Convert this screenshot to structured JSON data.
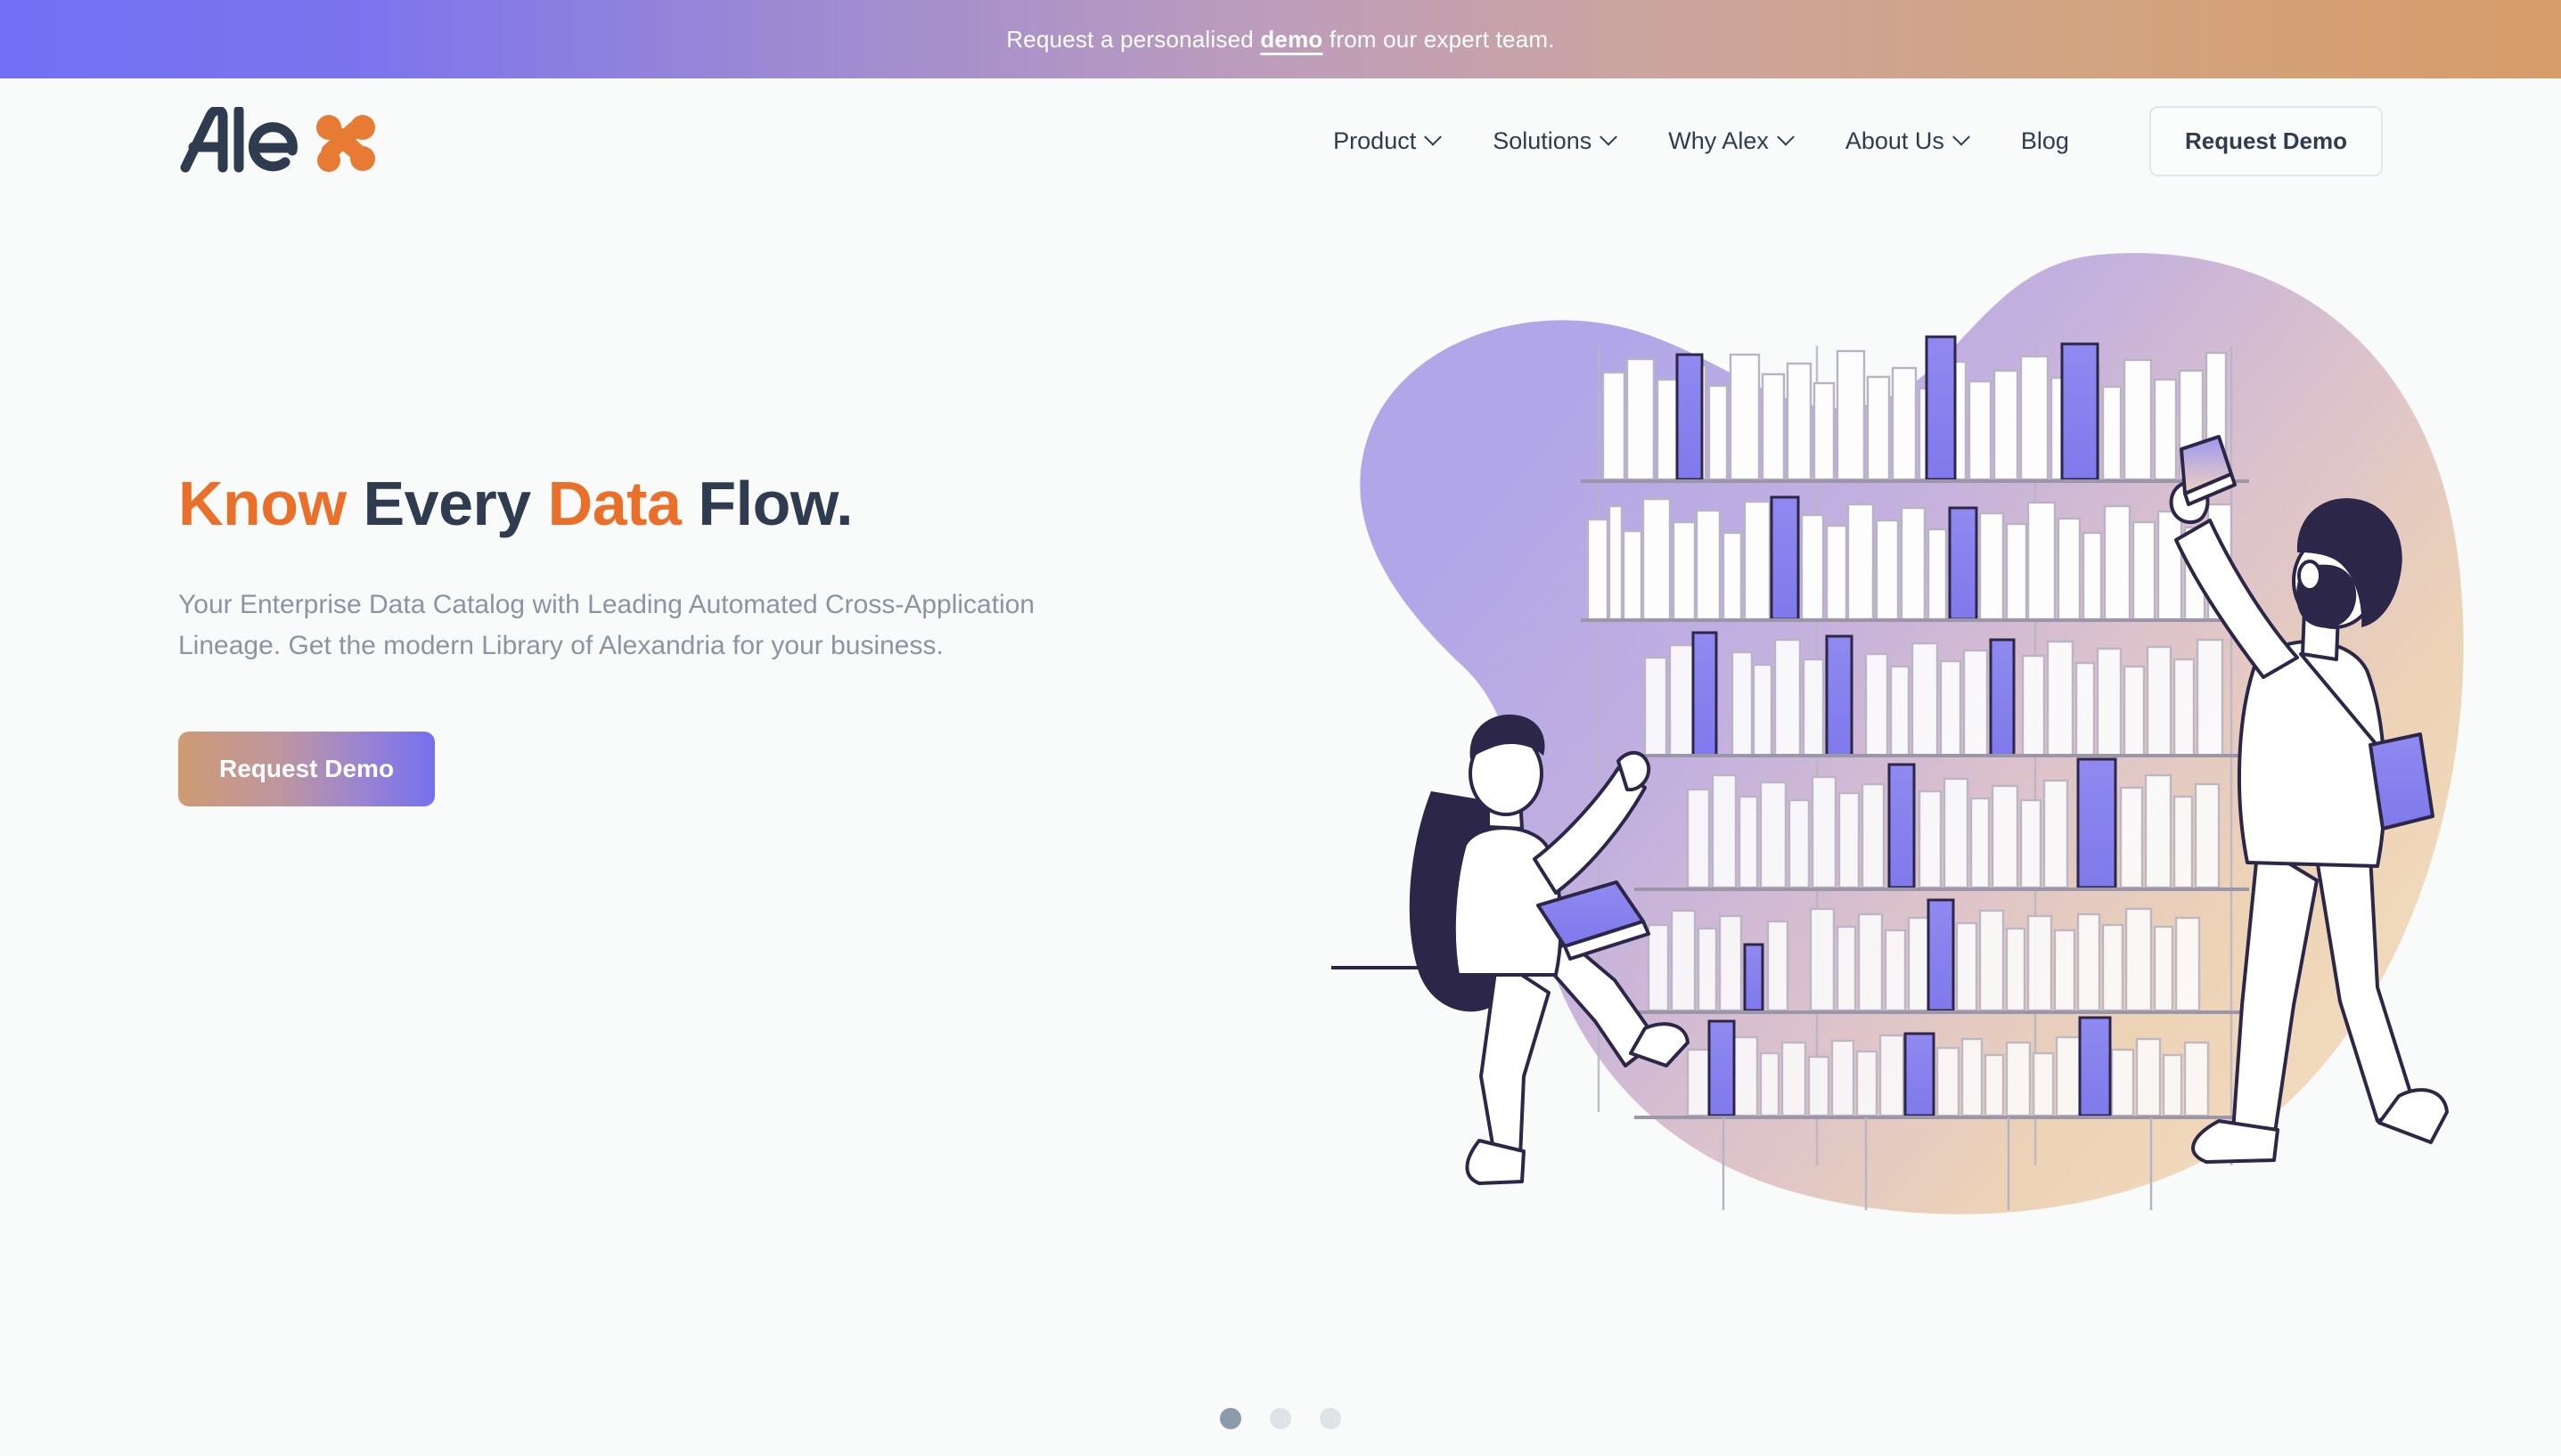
{
  "banner": {
    "text_before": "Request a personalised ",
    "link_label": "demo",
    "text_after": " from our expert team.",
    "gradient_from": "#7370F5",
    "gradient_to": "#D79C68"
  },
  "header": {
    "logo_text": "Alex",
    "logo_word_mark": "Ale",
    "logo_icon_name": "alex-x-node-icon",
    "logo_navy": "#2F3B4F",
    "logo_orange": "#E87B33",
    "nav": [
      {
        "label": "Product",
        "has_dropdown": true
      },
      {
        "label": "Solutions",
        "has_dropdown": true
      },
      {
        "label": "Why Alex",
        "has_dropdown": true
      },
      {
        "label": "About Us",
        "has_dropdown": true
      },
      {
        "label": "Blog",
        "has_dropdown": false
      }
    ],
    "cta_label": "Request Demo"
  },
  "hero": {
    "title_parts": [
      {
        "text": "Know",
        "color": "#EA7029"
      },
      {
        "text": "Every",
        "color": "#2F3B4F"
      },
      {
        "text": "Data",
        "color": "#EA7029"
      },
      {
        "text": "Flow.",
        "color": "#2F3B4F"
      }
    ],
    "title_word_1": "Know",
    "title_word_2": "Every",
    "title_word_3": "Data",
    "title_word_4": "Flow.",
    "subtitle": "Your Enterprise Data Catalog with Leading Automated Cross-Application Lineage. Get the modern Library of Alexandria for your business.",
    "cta_label": "Request Demo",
    "illustration_name": "library-bookshelf-illustration",
    "illustration_alt": "Two people browsing a tall bookshelf filled with books, purple and peach gradient blob background"
  },
  "carousel": {
    "total_slides": 3,
    "active_slide": 1
  },
  "colors": {
    "page_background": "#F9FAFA",
    "accent_orange": "#EA7029",
    "accent_navy": "#2F3B4F",
    "accent_purple": "#7570EE",
    "muted_text": "#8C93A1",
    "dot_active": "#8D9AAB",
    "dot_inactive": "#DFE3E8"
  }
}
